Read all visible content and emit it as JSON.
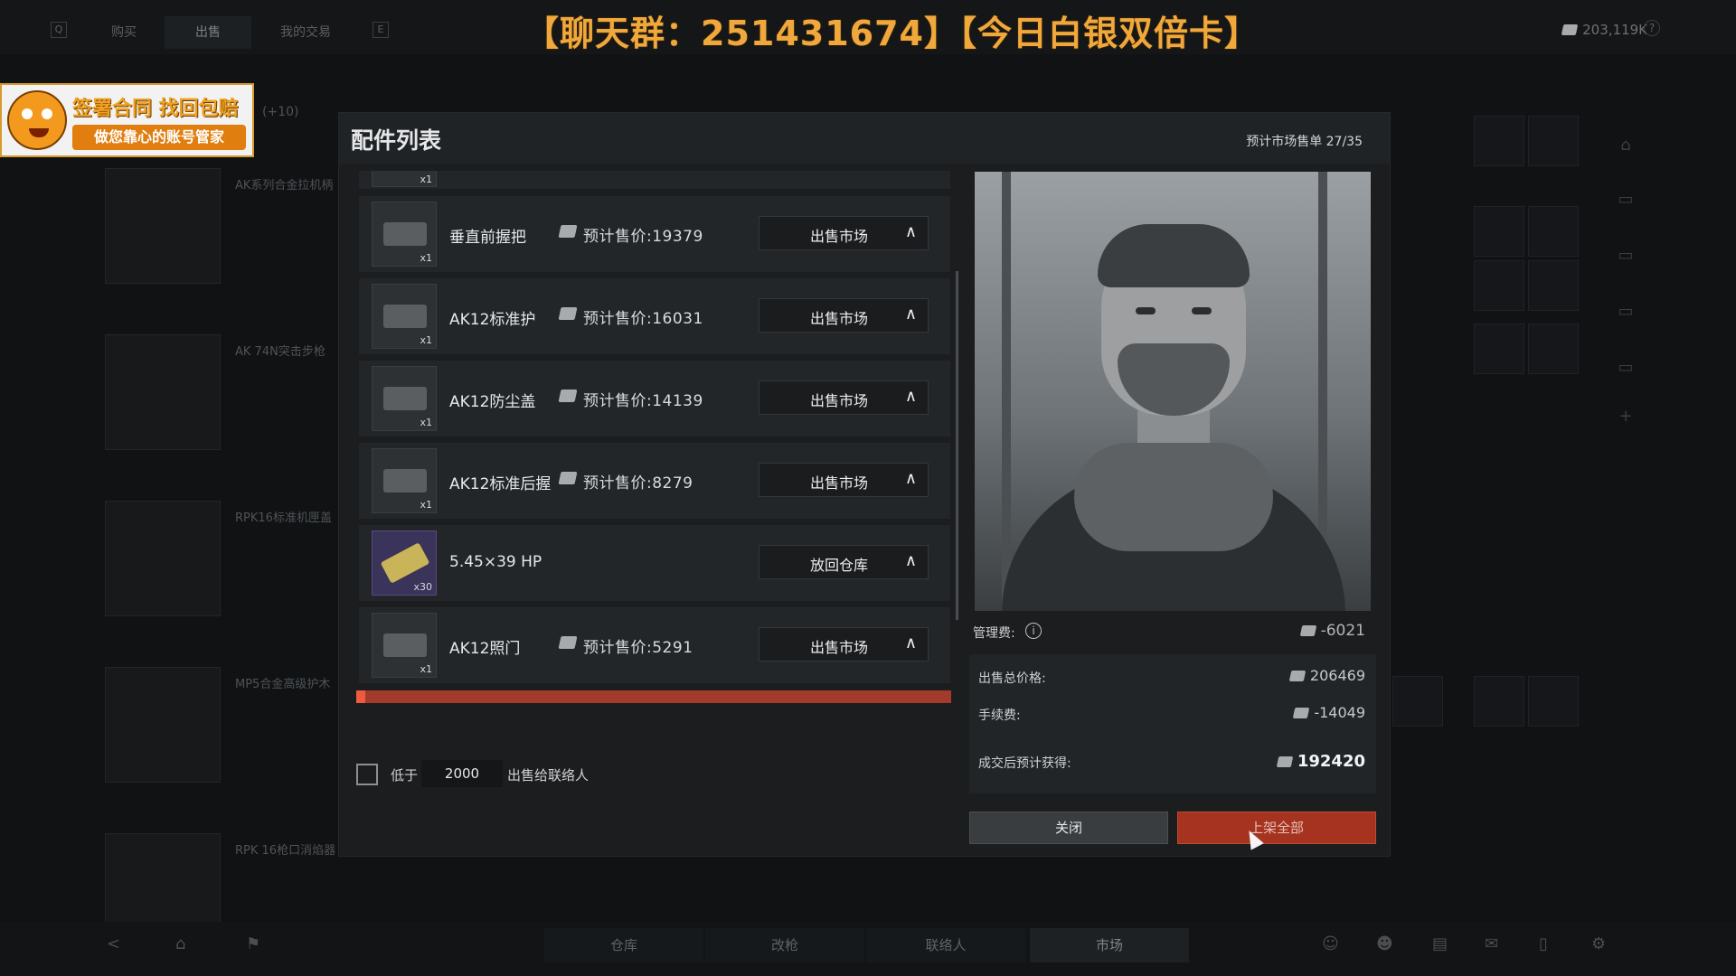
{
  "background": {
    "top_tabs": [
      {
        "label": "购买"
      },
      {
        "label": "出售"
      },
      {
        "label": "我的交易"
      }
    ],
    "top_keys": [
      "Q",
      "E"
    ],
    "currency_total": "203,119K",
    "help_symbol": "?",
    "extra_label": "(+10)",
    "left_items": [
      {
        "name": "AK系列合金拉机柄"
      },
      {
        "name": "AK 74N突击步枪"
      },
      {
        "name": "RPK16标准机匣盖"
      },
      {
        "name": "MP5合金高级护木"
      },
      {
        "name": "RPK 16枪口消焰器"
      }
    ],
    "bottom_tabs": [
      {
        "label": "仓库"
      },
      {
        "label": "改枪"
      },
      {
        "label": "联络人"
      },
      {
        "label": "市场"
      }
    ]
  },
  "overlay": {
    "banner": "【聊天群：251431674】【今日白银双倍卡】",
    "ad_line1": "签署合同 找回包赔",
    "ad_line2": "做您靠心的账号管家"
  },
  "modal": {
    "title": "配件列表",
    "counter": "预计市场售单 27/35",
    "top_partial_qty": "x1",
    "items": [
      {
        "name": "垂直前握把",
        "qty": "x1",
        "price": "预计售价:19379",
        "action": "出售市场",
        "icon": "grip-icon",
        "special": false
      },
      {
        "name": "AK12标准护",
        "qty": "x1",
        "price": "预计售价:16031",
        "action": "出售市场",
        "icon": "handguard-icon",
        "special": false
      },
      {
        "name": "AK12防尘盖",
        "qty": "x1",
        "price": "预计售价:14139",
        "action": "出售市场",
        "icon": "dustcover-icon",
        "special": false
      },
      {
        "name": "AK12标准后握",
        "qty": "x1",
        "price": "预计售价:8279",
        "action": "出售市场",
        "icon": "pistol-grip-icon",
        "special": false
      },
      {
        "name": "5.45×39 HP",
        "qty": "x30",
        "price": "",
        "action": "放回仓库",
        "icon": "ammo-icon",
        "special": true
      },
      {
        "name": "AK12照门",
        "qty": "x1",
        "price": "预计售价:5291",
        "action": "出售市场",
        "icon": "rear-sight-icon",
        "special": false
      }
    ],
    "filter": {
      "label_before": "低于",
      "value": "2000",
      "label_after": "出售给联络人",
      "checked": false
    },
    "fees": {
      "management_label": "管理费:",
      "management_value": "-6021",
      "total_label": "出售总价格:",
      "total_value": "206469",
      "commission_label": "手续费:",
      "commission_value": "-14049",
      "net_label": "成交后预计获得:",
      "net_value": "192420"
    },
    "buttons": {
      "close": "关闭",
      "list_all": "上架全部"
    },
    "colors": {
      "accent_red": "#a6331f",
      "banner_orange": "#f0a83c"
    }
  }
}
